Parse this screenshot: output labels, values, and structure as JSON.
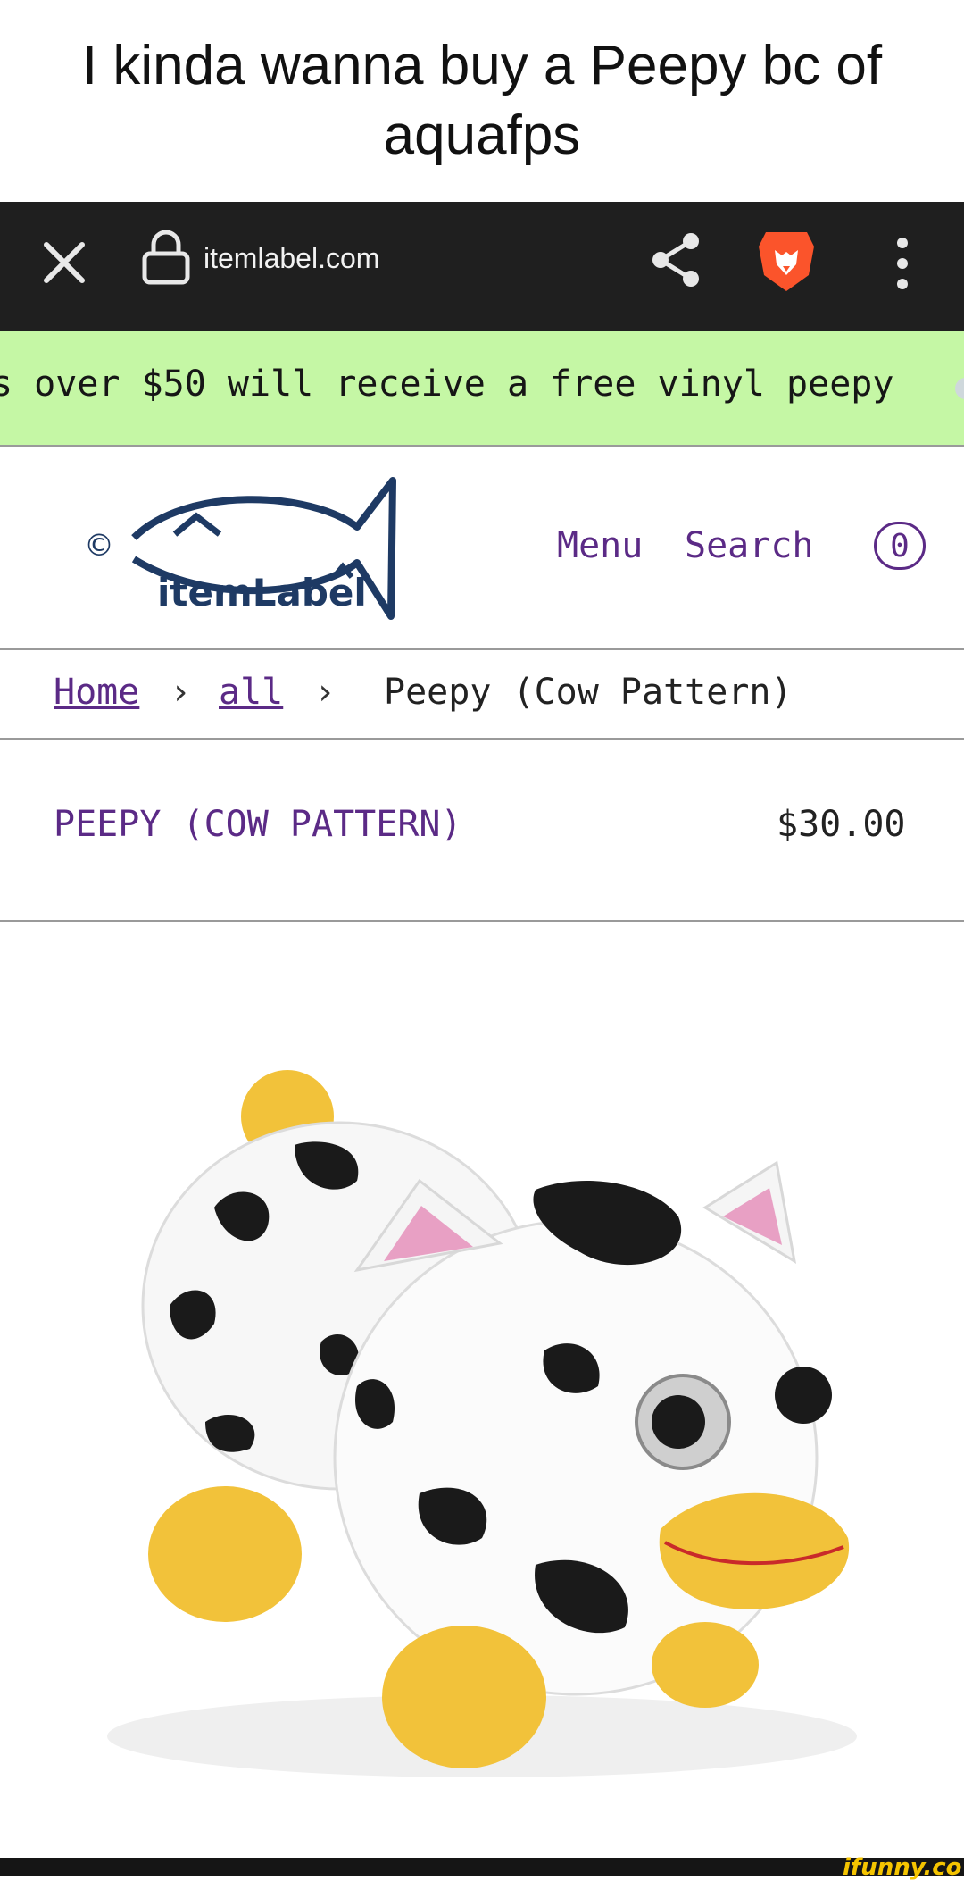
{
  "caption": {
    "text": "I kinda wanna buy a Peepy bc of aquafps"
  },
  "browser": {
    "url": "itemlabel.com",
    "icons": [
      "close-icon",
      "lock-icon",
      "share-icon",
      "brave-lion-icon",
      "more-vert-icon"
    ],
    "bar_color": "#1f1f1f"
  },
  "banner": {
    "text": "s over $50 will receive a free vinyl peepy",
    "background": "#c5f7a5"
  },
  "site": {
    "logo_text": "itemLabel",
    "logo_mark": "©",
    "nav": {
      "menu": "Menu",
      "search": "Search",
      "cart_count": "0"
    },
    "accent": "#5b2a86",
    "logo_color": "#1e3a64"
  },
  "breadcrumb": {
    "home": "Home",
    "sep1": "›",
    "all": "all",
    "sep2": "›",
    "current": "Peepy (Cow Pattern)"
  },
  "product": {
    "title": "PEEPY (COW PATTERN)",
    "price": "$30.00",
    "image_subject": "cow-pattern Peepy plush toy"
  },
  "watermark": {
    "text": "ifunny.co"
  }
}
